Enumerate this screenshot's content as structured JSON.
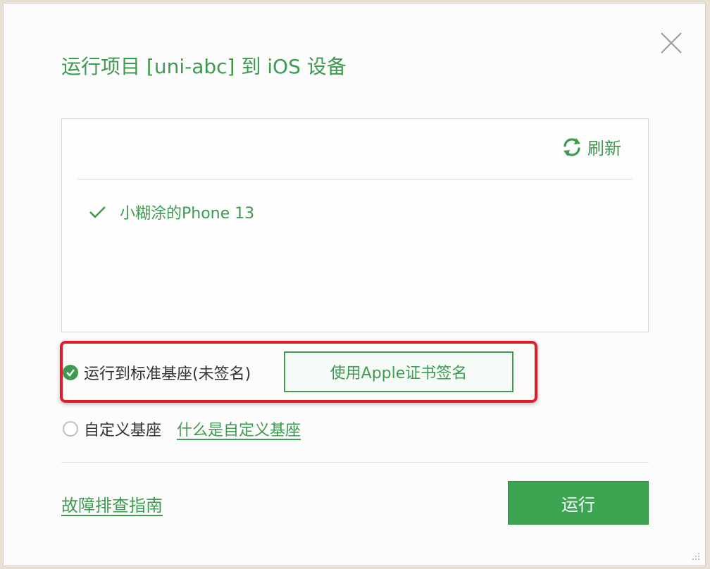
{
  "dialog": {
    "title": "运行项目 [uni-abc] 到 iOS 设备",
    "close_icon": "close-icon"
  },
  "device_panel": {
    "refresh_label": "刷新",
    "refresh_icon": "refresh-icon",
    "devices": [
      {
        "name": "小糊涂的Phone 13",
        "selected": true
      }
    ]
  },
  "options": {
    "standard_base_label": "运行到标准基座(未签名)",
    "standard_base_selected": true,
    "sign_button_label": "使用Apple证书签名",
    "custom_base_label": "自定义基座",
    "custom_base_selected": false,
    "custom_base_help_link": "什么是自定义基座"
  },
  "footer": {
    "troubleshoot_link": "故障排查指南",
    "run_button_label": "运行"
  },
  "colors": {
    "accent": "#3d9a4f",
    "highlight": "#e21a2b"
  }
}
